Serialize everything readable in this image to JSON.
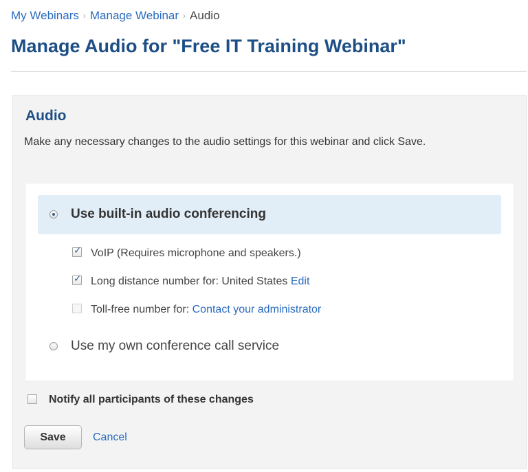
{
  "breadcrumb": {
    "items": [
      "My Webinars",
      "Manage Webinar",
      "Audio"
    ],
    "separator": "›"
  },
  "page_title": "Manage Audio for \"Free IT Training Webinar\"",
  "audio_section": {
    "title": "Audio",
    "description": "Make any necessary changes to the audio settings for this webinar and click Save.",
    "options": {
      "builtin": {
        "label": "Use built-in audio conferencing",
        "selected": true
      },
      "voip": {
        "label": "VoIP (Requires microphone and speakers.)",
        "checked": true
      },
      "long_distance": {
        "label": "Long distance number for: United States",
        "link": "Edit",
        "checked": true
      },
      "toll_free": {
        "label": "Toll-free number for:",
        "link": "Contact your administrator",
        "checked": false
      },
      "own_service": {
        "label": "Use my own conference call service",
        "selected": false
      }
    }
  },
  "notify": {
    "label": "Notify all participants of these changes",
    "checked": false
  },
  "actions": {
    "save_label": "Save",
    "cancel_label": "Cancel"
  },
  "colors": {
    "link": "#2a6bbf",
    "title": "#1d4f86",
    "selected_row_bg": "#e1eef8",
    "panel_bg": "#f3f3f3"
  }
}
